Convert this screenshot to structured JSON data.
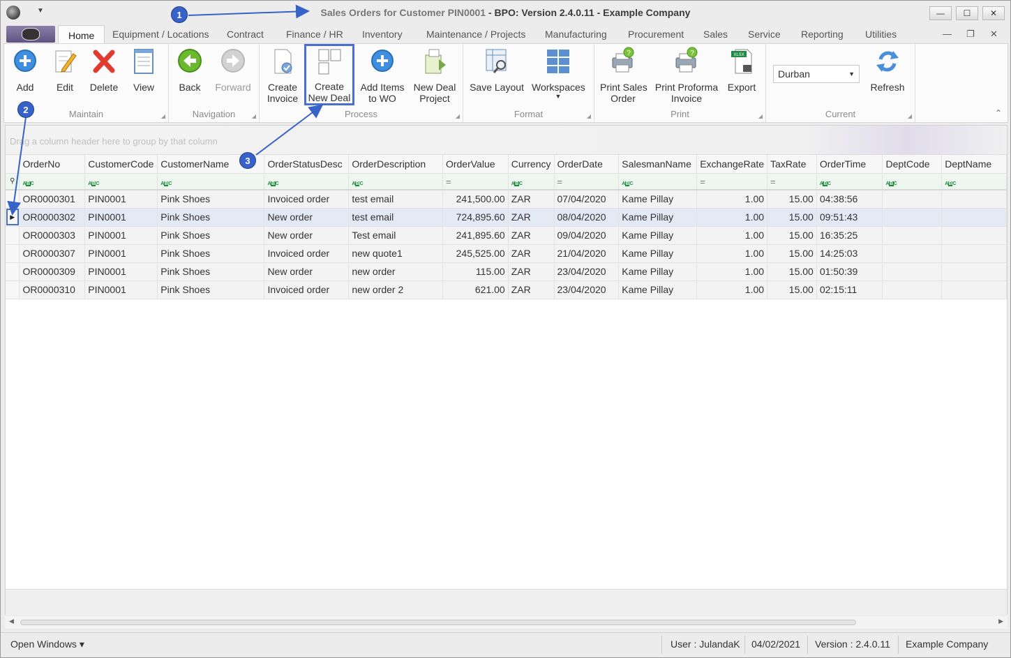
{
  "window": {
    "title_main": "Sales Orders for Customer PIN0001",
    "title_rest": " - BPO: Version 2.4.0.11 - Example Company",
    "minimize": "—",
    "maximize": "☐",
    "close": "✕"
  },
  "tabs": [
    "Home",
    "Equipment / Locations",
    "Contract",
    "Finance / HR",
    "Inventory",
    "Maintenance / Projects",
    "Manufacturing",
    "Procurement",
    "Sales",
    "Service",
    "Reporting",
    "Utilities"
  ],
  "mdi_controls": {
    "minimize": "—",
    "restore": "❐",
    "close": "✕"
  },
  "ribbon": {
    "groups": {
      "maintain": "Maintain",
      "navigation": "Navigation",
      "process": "Process",
      "format": "Format",
      "print": "Print",
      "current": "Current"
    },
    "buttons": {
      "add": "Add",
      "edit": "Edit",
      "delete": "Delete",
      "view": "View",
      "back": "Back",
      "forward": "Forward",
      "create_invoice_1": "Create",
      "create_invoice_2": "Invoice",
      "create_new_deal_1": "Create",
      "create_new_deal_2": "New Deal",
      "add_items_1": "Add Items",
      "add_items_2": "to WO",
      "new_deal_project_1": "New Deal",
      "new_deal_project_2": "Project",
      "save_layout": "Save Layout",
      "workspaces": "Workspaces",
      "print_sales_order_1": "Print Sales",
      "print_sales_order_2": "Order",
      "print_proforma_1": "Print Proforma",
      "print_proforma_2": "Invoice",
      "export": "Export",
      "refresh": "Refresh"
    },
    "current_branch": "Durban"
  },
  "grid": {
    "group_panel_hint": "Drag a column header here to group by that column",
    "columns": [
      "OrderNo",
      "CustomerCode",
      "CustomerName",
      "OrderStatusDesc",
      "OrderDescription",
      "OrderValue",
      "Currency",
      "OrderDate",
      "SalesmanName",
      "ExchangeRate",
      "TaxRate",
      "OrderTime",
      "DeptCode",
      "DeptName"
    ],
    "rows": [
      [
        "OR0000301",
        "PIN0001",
        "Pink Shoes",
        "Invoiced order",
        "test email",
        "241,500.00",
        "ZAR",
        "07/04/2020",
        "Kame Pillay",
        "1.00",
        "15.00",
        "04:38:56",
        "",
        ""
      ],
      [
        "OR0000302",
        "PIN0001",
        "Pink Shoes",
        "New order",
        "test email",
        "724,895.60",
        "ZAR",
        "08/04/2020",
        "Kame Pillay",
        "1.00",
        "15.00",
        "09:51:43",
        "",
        ""
      ],
      [
        "OR0000303",
        "PIN0001",
        "Pink Shoes",
        "New order",
        "Test email",
        "241,895.60",
        "ZAR",
        "09/04/2020",
        "Kame Pillay",
        "1.00",
        "15.00",
        "16:35:25",
        "",
        ""
      ],
      [
        "OR0000307",
        "PIN0001",
        "Pink Shoes",
        "Invoiced order",
        "new quote1",
        "245,525.00",
        "ZAR",
        "21/04/2020",
        "Kame Pillay",
        "1.00",
        "15.00",
        "14:25:03",
        "",
        ""
      ],
      [
        "OR0000309",
        "PIN0001",
        "Pink Shoes",
        "New order",
        "new order",
        "115.00",
        "ZAR",
        "23/04/2020",
        "Kame Pillay",
        "1.00",
        "15.00",
        "01:50:39",
        "",
        ""
      ],
      [
        "OR0000310",
        "PIN0001",
        "Pink Shoes",
        "Invoiced order",
        "new order 2",
        "621.00",
        "ZAR",
        "23/04/2020",
        "Kame Pillay",
        "1.00",
        "15.00",
        "02:15:11",
        "",
        ""
      ]
    ],
    "selected_row": 1
  },
  "statusbar": {
    "open_windows": "Open Windows ▾",
    "user": "User : JulandaK",
    "date": "04/02/2021",
    "version": "Version : 2.4.0.11",
    "company": "Example Company"
  },
  "callouts": [
    "1",
    "2",
    "3"
  ],
  "colors": {
    "accent": "#3763c8",
    "highlight_box": "#4a6fd1",
    "selected_row": "#e3e9f5"
  }
}
